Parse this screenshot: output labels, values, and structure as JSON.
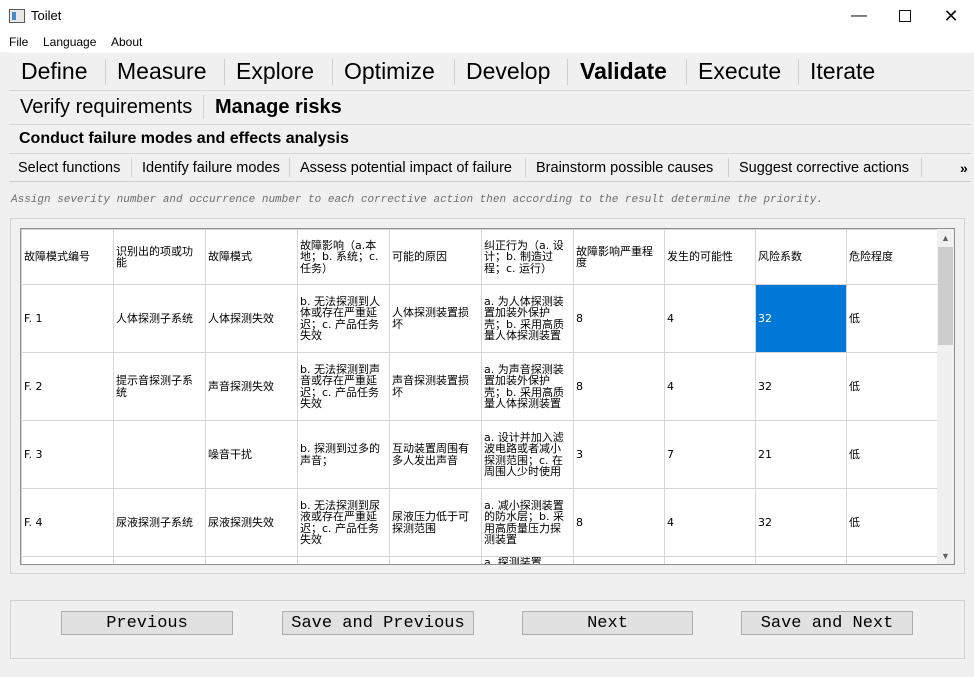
{
  "window": {
    "title": "Toilet",
    "minimize_icon": "minimize-icon",
    "maximize_icon": "maximize-icon",
    "close_icon": "close-icon"
  },
  "menu": [
    "File",
    "Language",
    "About"
  ],
  "phases": {
    "items": [
      "Define",
      "Measure",
      "Explore",
      "Optimize",
      "Develop",
      "Validate",
      "Execute",
      "Iterate"
    ],
    "active": "Validate"
  },
  "subphases": {
    "items": [
      "Verify requirements",
      "Manage risks"
    ],
    "active": "Manage risks"
  },
  "section_title": "Conduct failure modes and effects analysis",
  "steps": {
    "items": [
      "Select functions",
      "Identify failure modes",
      "Assess potential impact of failure",
      "Brainstorm possible causes",
      "Suggest corrective actions"
    ],
    "overflow": "»"
  },
  "instruction": "Assign severity number and occurrence number to each corrective action then according to the result determine the priority.",
  "table": {
    "headers": [
      "故障模式编号",
      "识别出的项或功能",
      "故障模式",
      "故障影响（a.本地；b. 系统；c. 任务）",
      "可能的原因",
      "纠正行为（a. 设计；b. 制造过程；c. 运行）",
      "故障影响严重程度",
      "发生的可能性",
      "风险系数",
      "危险程度"
    ],
    "rows": [
      [
        "F. 1",
        "人体探测子系统",
        "人体探测失效",
        "b. 无法探测到人体或存在严重延迟；c. 产品任务失效",
        "人体探测装置损坏",
        "a. 为人体探测装置加装外保护壳；b. 采用高质量人体探测装置",
        "8",
        "4",
        "32",
        "低"
      ],
      [
        "F. 2",
        "提示音探测子系统",
        "声音探测失效",
        "b. 无法探测到声音或存在严重延迟；c. 产品任务失效",
        "声音探测装置损坏",
        "a. 为声音探测装置加装外保护壳；b. 采用高质量人体探测装置",
        "8",
        "4",
        "32",
        "低"
      ],
      [
        "F. 3",
        "",
        "噪音干扰",
        "b. 探测到过多的声音；",
        "互动装置周围有多人发出声音",
        "a. 设计并加入滤波电路或者减小探测范围；c. 在周围人少时使用",
        "3",
        "7",
        "21",
        "低"
      ],
      [
        "F. 4",
        "尿液探测子系统",
        "尿液探测失效",
        "b. 无法探测到尿液或存在严重延迟；c. 产品任务失效",
        "尿液压力低于可探测范围",
        "a. 减小探测装置的防水层；b. 采用高质量压力探测装置",
        "8",
        "4",
        "32",
        "低"
      ],
      [
        "",
        "",
        "",
        "",
        "",
        "a. 探测装置",
        "",
        "",
        "",
        ""
      ]
    ],
    "selected_cell": {
      "row": 0,
      "col": 8
    }
  },
  "buttons": {
    "previous": "Previous",
    "save_previous": "Save and Previous",
    "next": "Next",
    "save_next": "Save and Next"
  },
  "colors": {
    "selection": "#0078d7",
    "background": "#f0f0f0"
  }
}
